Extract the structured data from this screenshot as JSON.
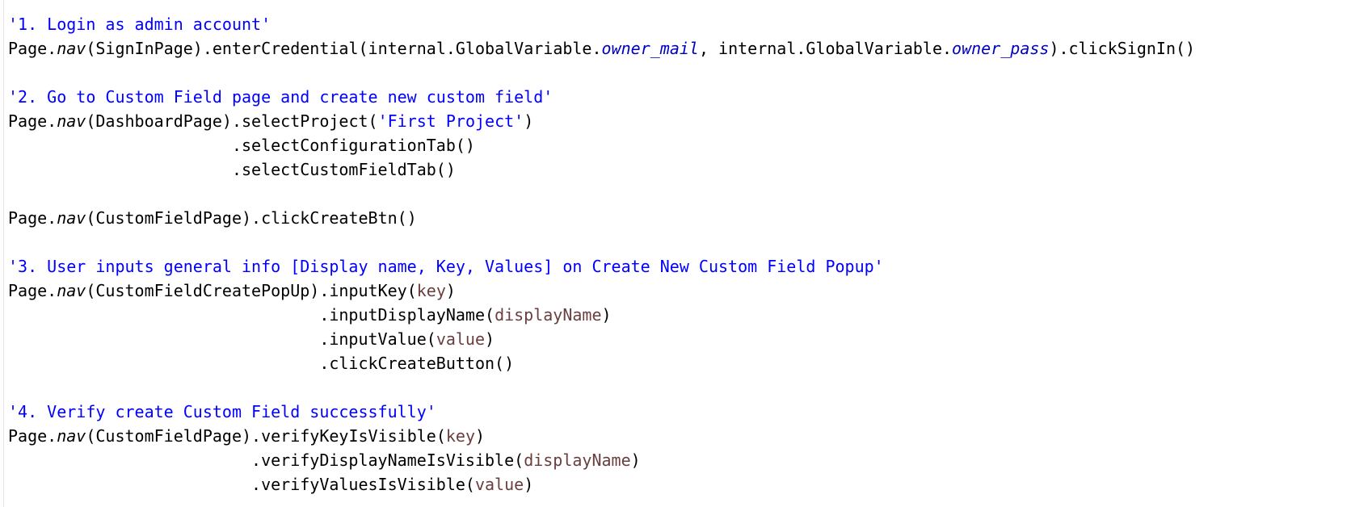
{
  "editor": {
    "lines": [
      {
        "parts": [
          {
            "text": "'1. Login as admin account'",
            "style": "comment"
          }
        ]
      },
      {
        "parts": [
          {
            "text": "Page.",
            "style": "plain"
          },
          {
            "text": "nav",
            "style": "it"
          },
          {
            "text": "(SignInPage).enterCredential(internal.GlobalVariable.",
            "style": "plain"
          },
          {
            "text": "owner_mail",
            "style": "field"
          },
          {
            "text": ", internal.GlobalVariable.",
            "style": "plain"
          },
          {
            "text": "owner_pass",
            "style": "field"
          },
          {
            "text": ").clickSignIn()",
            "style": "plain"
          }
        ]
      },
      {
        "parts": []
      },
      {
        "parts": [
          {
            "text": "'2. Go to Custom Field page and create new custom field'",
            "style": "comment"
          }
        ]
      },
      {
        "parts": [
          {
            "text": "Page.",
            "style": "plain"
          },
          {
            "text": "nav",
            "style": "it"
          },
          {
            "text": "(DashboardPage).selectProject(",
            "style": "plain"
          },
          {
            "text": "'First Project'",
            "style": "str"
          },
          {
            "text": ")",
            "style": "plain"
          }
        ]
      },
      {
        "parts": [
          {
            "text": "                       .selectConfigurationTab()",
            "style": "plain"
          }
        ]
      },
      {
        "parts": [
          {
            "text": "                       .selectCustomFieldTab()",
            "style": "plain"
          }
        ]
      },
      {
        "parts": []
      },
      {
        "parts": [
          {
            "text": "Page.",
            "style": "plain"
          },
          {
            "text": "nav",
            "style": "it"
          },
          {
            "text": "(CustomFieldPage).clickCreateBtn()",
            "style": "plain"
          }
        ]
      },
      {
        "parts": []
      },
      {
        "parts": [
          {
            "text": "'3. User inputs general info [Display name, Key, Values] on Create New Custom Field Popup'",
            "style": "comment"
          }
        ]
      },
      {
        "parts": [
          {
            "text": "Page.",
            "style": "plain"
          },
          {
            "text": "nav",
            "style": "it"
          },
          {
            "text": "(CustomFieldCreatePopUp).inputKey(",
            "style": "plain"
          },
          {
            "text": "key",
            "style": "var"
          },
          {
            "text": ")",
            "style": "plain"
          }
        ]
      },
      {
        "parts": [
          {
            "text": "                                .inputDisplayName(",
            "style": "plain"
          },
          {
            "text": "displayName",
            "style": "var"
          },
          {
            "text": ")",
            "style": "plain"
          }
        ]
      },
      {
        "parts": [
          {
            "text": "                                .inputValue(",
            "style": "plain"
          },
          {
            "text": "value",
            "style": "var"
          },
          {
            "text": ")",
            "style": "plain"
          }
        ]
      },
      {
        "parts": [
          {
            "text": "                                .clickCreateButton()",
            "style": "plain"
          }
        ]
      },
      {
        "parts": []
      },
      {
        "parts": [
          {
            "text": "'4. Verify create Custom Field successfully'",
            "style": "comment"
          }
        ]
      },
      {
        "parts": [
          {
            "text": "Page.",
            "style": "plain"
          },
          {
            "text": "nav",
            "style": "it"
          },
          {
            "text": "(CustomFieldPage).verifyKeyIsVisible(",
            "style": "plain"
          },
          {
            "text": "key",
            "style": "var"
          },
          {
            "text": ")",
            "style": "plain"
          }
        ]
      },
      {
        "parts": [
          {
            "text": "                         .verifyDisplayNameIsVisible(",
            "style": "plain"
          },
          {
            "text": "displayName",
            "style": "var"
          },
          {
            "text": ")",
            "style": "plain"
          }
        ]
      },
      {
        "parts": [
          {
            "text": "                         .verifyValuesIsVisible(",
            "style": "plain"
          },
          {
            "text": "value",
            "style": "var"
          },
          {
            "text": ")",
            "style": "plain"
          }
        ]
      }
    ]
  }
}
